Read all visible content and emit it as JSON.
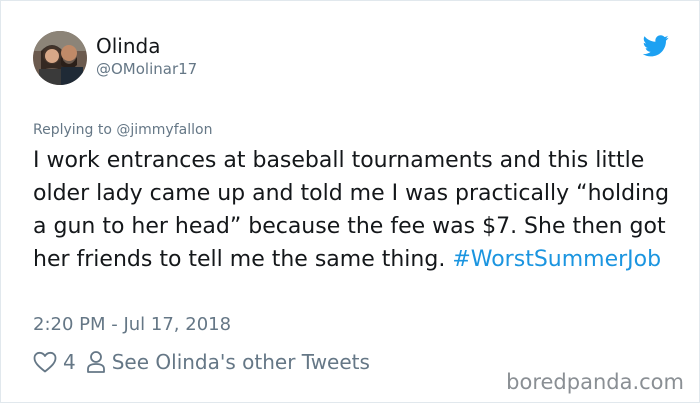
{
  "tweet": {
    "display_name": "Olinda",
    "handle": "@OMolinar17",
    "replying_to": "Replying to @jimmyfallon",
    "text": "I work entrances at baseball tournaments and this little older lady came up and told me I was practically “holding a gun to her head” because the fee was $7. She then got her friends to tell me the same thing.",
    "hashtag": "#WorstSummerJob",
    "timestamp": "2:20 PM - Jul 17, 2018",
    "like_count": "4",
    "other_tweets_link": "See Olinda's other Tweets"
  },
  "watermark": "boredpanda.com",
  "icons": {
    "platform": "twitter-bird-icon",
    "like": "heart-icon",
    "profile": "person-icon"
  },
  "colors": {
    "brand": "#1da1f2",
    "hashtag": "#1b95e0",
    "text": "#14171a",
    "muted": "#657786"
  }
}
